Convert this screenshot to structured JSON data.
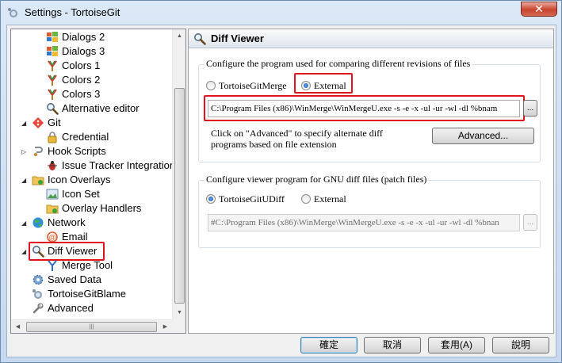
{
  "window": {
    "title": "Settings - TortoiseGit",
    "close_label": "✕"
  },
  "tree": {
    "items": [
      {
        "label": "Dialogs 2",
        "icon": "windows-flag-icon"
      },
      {
        "label": "Dialogs 3",
        "icon": "windows-flag-icon"
      },
      {
        "label": "Colors 1",
        "icon": "paint-brush-icon"
      },
      {
        "label": "Colors 2",
        "icon": "paint-brush-icon"
      },
      {
        "label": "Colors 3",
        "icon": "paint-brush-icon"
      },
      {
        "label": "Alternative editor",
        "icon": "magnifier-icon"
      },
      {
        "label": "Git",
        "icon": "git-icon"
      },
      {
        "label": "Credential",
        "icon": "lock-icon"
      },
      {
        "label": "Hook Scripts",
        "icon": "hook-icon"
      },
      {
        "label": "Issue Tracker Integration",
        "icon": "bug-icon"
      },
      {
        "label": "Icon Overlays",
        "icon": "folder-overlay-icon"
      },
      {
        "label": "Icon Set",
        "icon": "image-icon"
      },
      {
        "label": "Overlay Handlers",
        "icon": "folder-overlay-icon"
      },
      {
        "label": "Network",
        "icon": "globe-icon"
      },
      {
        "label": "Email",
        "icon": "email-icon"
      },
      {
        "label": "Diff Viewer",
        "icon": "magnifier-icon"
      },
      {
        "label": "Merge Tool",
        "icon": "merge-icon"
      },
      {
        "label": "Saved Data",
        "icon": "gear-icon"
      },
      {
        "label": "TortoiseGitBlame",
        "icon": "tortoise-icon"
      },
      {
        "label": "Advanced",
        "icon": "wrench-icon"
      }
    ],
    "selected": "Diff Viewer"
  },
  "panel": {
    "title": "Diff Viewer",
    "group1": {
      "legend": "Configure the program used for comparing different revisions of files",
      "radio_internal": "TortoiseGitMerge",
      "radio_external": "External",
      "selected": "External",
      "path_value": "C:\\Program Files (x86)\\WinMerge\\WinMergeU.exe -s -e -x -ul -ur -wl -dl %bnam",
      "browse_label": "...",
      "note": "Click on \"Advanced\" to specify alternate diff programs based on file extension",
      "advanced_label": "Advanced..."
    },
    "group2": {
      "legend": "Configure viewer program for GNU diff files (patch files)",
      "radio_internal": "TortoiseGitUDiff",
      "radio_external": "External",
      "selected": "TortoiseGitUDiff",
      "path_value": "#C:\\Program Files (x86)\\WinMerge\\WinMergeU.exe -s -e -x -ul -ur -wl -dl %bnan",
      "browse_label": "..."
    }
  },
  "footer": {
    "ok": "確定",
    "cancel": "取消",
    "apply": "套用(A)",
    "help": "說明"
  },
  "colors": {
    "highlight": "#e0141e",
    "accent": "#1f5eb0"
  }
}
